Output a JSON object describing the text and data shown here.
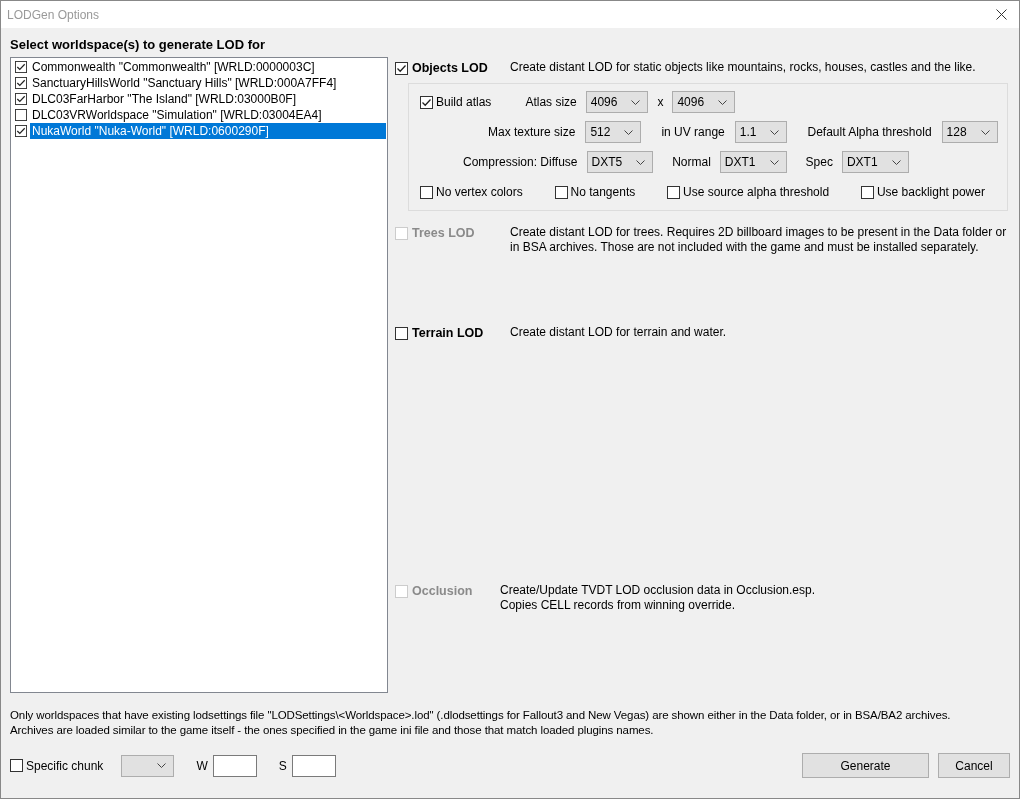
{
  "window": {
    "title": "LODGen Options"
  },
  "worldspace_list": {
    "heading": "Select worldspace(s) to generate LOD for",
    "items": [
      {
        "label": "Commonwealth \"Commonwealth\" [WRLD:0000003C]",
        "checked": true,
        "selected": false
      },
      {
        "label": "SanctuaryHillsWorld \"Sanctuary Hills\" [WRLD:000A7FF4]",
        "checked": true,
        "selected": false
      },
      {
        "label": "DLC03FarHarbor \"The Island\" [WRLD:03000B0F]",
        "checked": true,
        "selected": false
      },
      {
        "label": "DLC03VRWorldspace \"Simulation\" [WRLD:03004EA4]",
        "checked": false,
        "selected": false
      },
      {
        "label": "NukaWorld \"Nuka-World\" [WRLD:0600290F]",
        "checked": true,
        "selected": true
      }
    ]
  },
  "sections": [
    {
      "kind": "objects",
      "label": "Objects LOD",
      "checked": true,
      "disabled": false,
      "description": [
        "Create distant LOD for static objects like mountains, rocks, houses, castles and the like."
      ],
      "options": [
        [
          {
            "kind": "checkbox",
            "label": "Build atlas",
            "checked": true
          },
          {
            "kind": "label",
            "label": "Atlas size"
          },
          {
            "kind": "dropdown",
            "value": "4096"
          },
          {
            "kind": "label",
            "label": "x"
          },
          {
            "kind": "dropdown",
            "value": "4096"
          }
        ],
        [
          {
            "kind": "label",
            "label": "Max texture size"
          },
          {
            "kind": "dropdown",
            "value": "512"
          },
          {
            "kind": "label",
            "label": "in UV range"
          },
          {
            "kind": "dropdown",
            "value": "1.1"
          },
          {
            "kind": "label",
            "label": "Default Alpha threshold"
          },
          {
            "kind": "dropdown",
            "value": "128"
          }
        ],
        [
          {
            "kind": "label",
            "label": "Compression: Diffuse"
          },
          {
            "kind": "dropdown",
            "value": "DXT5"
          },
          {
            "kind": "label",
            "label": "Normal"
          },
          {
            "kind": "dropdown",
            "value": "DXT1"
          },
          {
            "kind": "label",
            "label": "Spec"
          },
          {
            "kind": "dropdown",
            "value": "DXT1"
          }
        ],
        [
          {
            "kind": "checkbox",
            "label": "No vertex colors",
            "checked": false
          },
          {
            "kind": "checkbox",
            "label": "No tangents",
            "checked": false
          },
          {
            "kind": "checkbox",
            "label": "Use source alpha threshold",
            "checked": false
          },
          {
            "kind": "checkbox",
            "label": "Use backlight power",
            "checked": false
          }
        ]
      ]
    },
    {
      "kind": "trees",
      "label": "Trees LOD",
      "checked": false,
      "disabled": true,
      "description": [
        "Create distant LOD for trees. Requires 2D billboard images to be present in the Data folder or",
        "in BSA archives. Those are not included with the game and must be installed separately."
      ]
    },
    {
      "kind": "terrain",
      "label": "Terrain LOD",
      "checked": false,
      "disabled": false,
      "description": [
        "Create distant LOD for terrain and water."
      ]
    },
    {
      "kind": "occlusion",
      "label": "Occlusion",
      "checked": false,
      "disabled": true,
      "description": [
        "Create/Update TVDT LOD occlusion data in Occlusion.esp.",
        "Copies CELL records from winning override."
      ]
    }
  ],
  "notes": [
    "Only worldspaces that have existing lodsettings file \"LODSettings\\<Worldspace>.lod\" (.dlodsettings for Fallout3 and New Vegas) are shown either in the Data folder, or in BSA/BA2 archives.",
    "Archives are loaded similar to the game itself - the ones specified in the game ini file and those that match loaded plugins names."
  ],
  "footer": {
    "specific_chunk": {
      "label": "Specific chunk",
      "checked": false
    },
    "w_label": "W",
    "s_label": "S",
    "buttons": [
      "Generate",
      "Cancel"
    ]
  }
}
